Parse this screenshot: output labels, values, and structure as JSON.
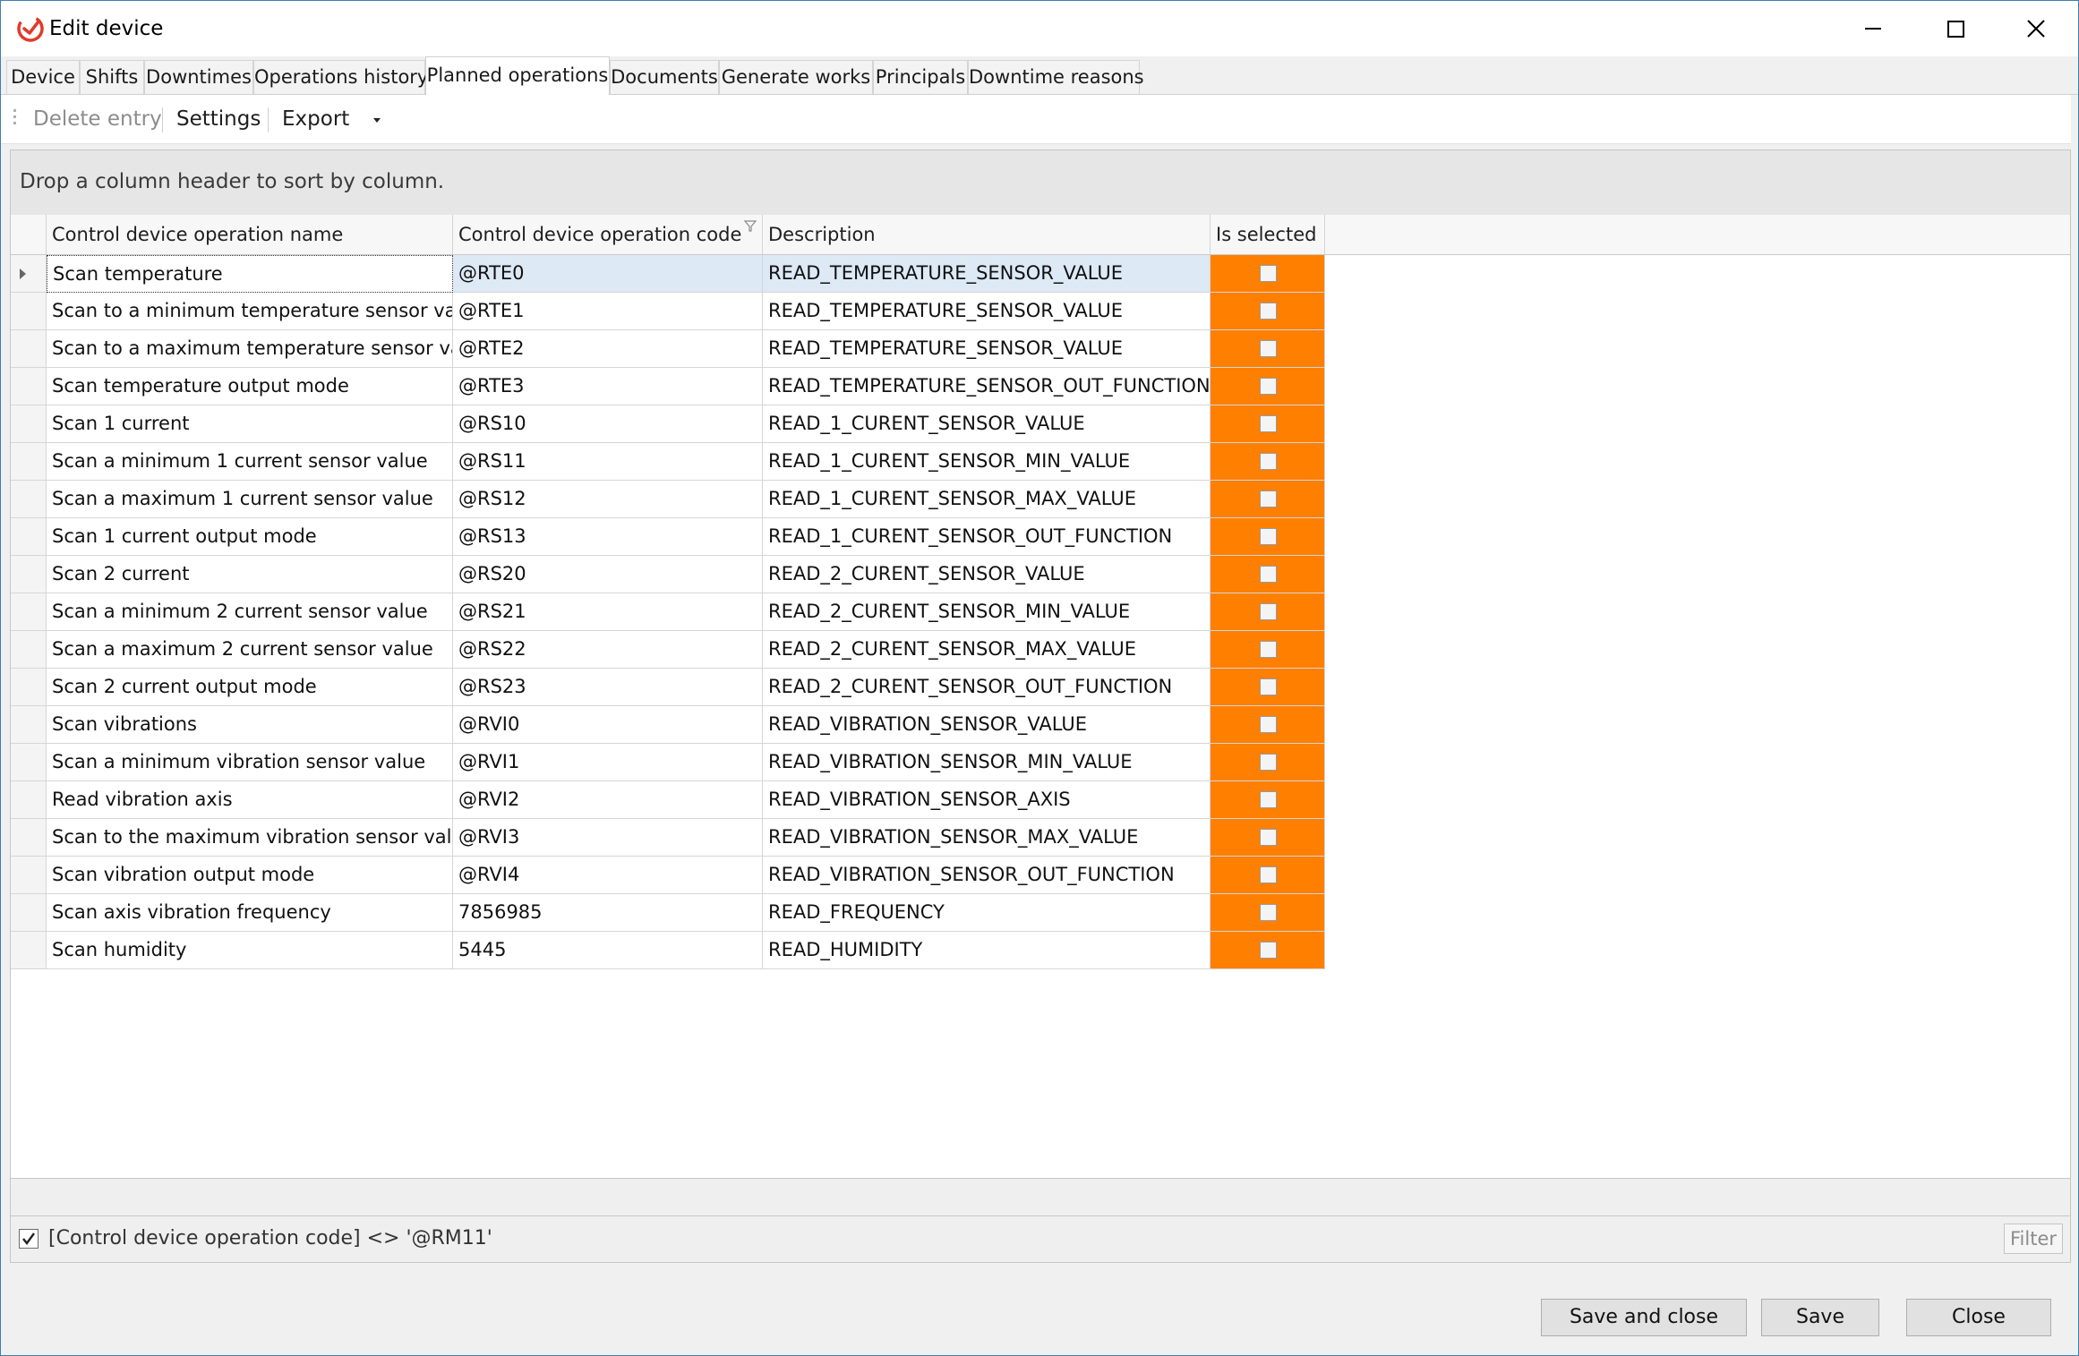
{
  "window": {
    "title": "Edit device",
    "minimize_icon": "minimize-icon",
    "maximize_icon": "maximize-icon",
    "close_icon": "close-icon",
    "app_icon": "app-logo-icon",
    "accent": "#e03b2b"
  },
  "tabs": [
    {
      "label": "Device"
    },
    {
      "label": "Shifts"
    },
    {
      "label": "Downtimes"
    },
    {
      "label": "Operations history"
    },
    {
      "label": "Planned operations",
      "active": true
    },
    {
      "label": "Documents"
    },
    {
      "label": "Generate works"
    },
    {
      "label": "Principals"
    },
    {
      "label": "Downtime reasons"
    }
  ],
  "toolbar": {
    "delete_label": "Delete entry",
    "settings_label": "Settings",
    "export_label": "Export",
    "export_icon": "dropdown-arrow-icon"
  },
  "grid": {
    "group_panel_text": "Drop a column header to sort by column.",
    "columns": [
      {
        "label": "Control device operation name"
      },
      {
        "label": "Control device operation code",
        "filter_icon": "filter-icon"
      },
      {
        "label": "Description"
      },
      {
        "label": "Is selected"
      }
    ],
    "selected_color": "#ff7f00",
    "rows": [
      {
        "name": "Scan temperature",
        "code": "@RTE0",
        "description": "READ_TEMPERATURE_SENSOR_VALUE",
        "selected": false
      },
      {
        "name": "Scan to a minimum temperature sensor value",
        "code": "@RTE1",
        "description": "READ_TEMPERATURE_SENSOR_VALUE",
        "selected": false
      },
      {
        "name": "Scan to a maximum temperature sensor value",
        "code": "@RTE2",
        "description": "READ_TEMPERATURE_SENSOR_VALUE",
        "selected": false
      },
      {
        "name": "Scan temperature output mode",
        "code": "@RTE3",
        "description": "READ_TEMPERATURE_SENSOR_OUT_FUNCTION",
        "selected": false
      },
      {
        "name": "Scan 1 current",
        "code": "@RS10",
        "description": "READ_1_CURENT_SENSOR_VALUE",
        "selected": false
      },
      {
        "name": "Scan  a minimum 1 current sensor value",
        "code": "@RS11",
        "description": "READ_1_CURENT_SENSOR_MIN_VALUE",
        "selected": false
      },
      {
        "name": "Scan  a maximum 1 current sensor value",
        "code": "@RS12",
        "description": "READ_1_CURENT_SENSOR_MAX_VALUE",
        "selected": false
      },
      {
        "name": "Scan 1 current output mode",
        "code": "@RS13",
        "description": "READ_1_CURENT_SENSOR_OUT_FUNCTION",
        "selected": false
      },
      {
        "name": "Scan 2 current",
        "code": "@RS20",
        "description": "READ_2_CURENT_SENSOR_VALUE",
        "selected": false
      },
      {
        "name": "Scan a minimum 2 current sensor value",
        "code": "@RS21",
        "description": "READ_2_CURENT_SENSOR_MIN_VALUE",
        "selected": false
      },
      {
        "name": "Scan a maximum 2 current sensor value",
        "code": "@RS22",
        "description": "READ_2_CURENT_SENSOR_MAX_VALUE",
        "selected": false
      },
      {
        "name": "Scan 2 current output mode",
        "code": "@RS23",
        "description": "READ_2_CURENT_SENSOR_OUT_FUNCTION",
        "selected": false
      },
      {
        "name": "Scan vibrations",
        "code": "@RVI0",
        "description": "READ_VIBRATION_SENSOR_VALUE",
        "selected": false
      },
      {
        "name": "Scan a minimum vibration sensor value",
        "code": "@RVI1",
        "description": "READ_VIBRATION_SENSOR_MIN_VALUE",
        "selected": false
      },
      {
        "name": "Read vibration axis",
        "code": "@RVI2",
        "description": "READ_VIBRATION_SENSOR_AXIS",
        "selected": false
      },
      {
        "name": "Scan to the maximum vibration sensor value",
        "code": "@RVI3",
        "description": "READ_VIBRATION_SENSOR_MAX_VALUE",
        "selected": false
      },
      {
        "name": "Scan vibration output mode",
        "code": "@RVI4",
        "description": "READ_VIBRATION_SENSOR_OUT_FUNCTION",
        "selected": false
      },
      {
        "name": "Scan axis vibration frequency",
        "code": "7856985",
        "description": "READ_FREQUENCY",
        "selected": false
      },
      {
        "name": "Scan humidity",
        "code": "5445",
        "description": "READ_HUMIDITY",
        "selected": false
      }
    ],
    "current_row_indicator_icon": "row-indicator-icon"
  },
  "filter_panel": {
    "enabled": true,
    "expression": "[Control device operation code] <> '@RM11'",
    "filter_button_label": "Filter",
    "check_icon": "checkmark-icon"
  },
  "buttons": {
    "save_and_close": "Save and close",
    "save": "Save",
    "close": "Close"
  }
}
